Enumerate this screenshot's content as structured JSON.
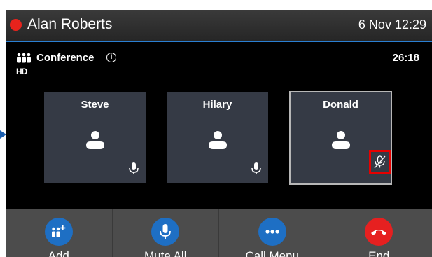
{
  "header": {
    "user_name": "Alan Roberts",
    "datetime": "6 Nov 12:29"
  },
  "call": {
    "type_label": "Conference",
    "hd_badge": "HD",
    "timer": "26:18"
  },
  "participants": [
    {
      "name": "Steve",
      "mic": "on"
    },
    {
      "name": "Hilary",
      "mic": "on"
    },
    {
      "name": "Donald",
      "mic": "muted",
      "selected": true
    }
  ],
  "softkeys": [
    {
      "label": "Add",
      "icon": "add-participant-icon"
    },
    {
      "label": "Mute All",
      "icon": "microphone-icon"
    },
    {
      "label": "Call Menu",
      "icon": "more-icon"
    },
    {
      "label": "End",
      "icon": "end-call-icon"
    }
  ],
  "colors": {
    "accent": "#1e6fc4",
    "end": "#e62020",
    "highlight": "#e60000",
    "status": "#e8231c"
  }
}
